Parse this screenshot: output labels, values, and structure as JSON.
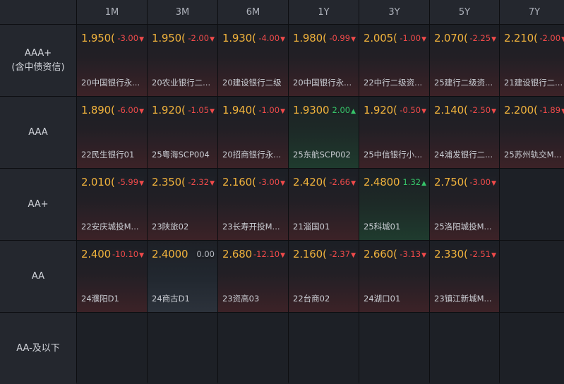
{
  "columns": [
    "1M",
    "3M",
    "6M",
    "1Y",
    "3Y",
    "5Y",
    "7Y"
  ],
  "rows": [
    {
      "label_line1": "AAA+",
      "label_line2": "(含中债资信)",
      "cells": [
        {
          "yield": "1.950(",
          "change": "-3.00",
          "dir": "down",
          "name": "20中国银行永..."
        },
        {
          "yield": "1.950(",
          "change": "-2.00",
          "dir": "down",
          "name": "20农业银行二..."
        },
        {
          "yield": "1.930(",
          "change": "-4.00",
          "dir": "down",
          "name": "20建设银行二级"
        },
        {
          "yield": "1.980(",
          "change": "-0.99",
          "dir": "down",
          "name": "20中国银行永..."
        },
        {
          "yield": "2.005(",
          "change": "-1.00",
          "dir": "down",
          "name": "22中行二级资..."
        },
        {
          "yield": "2.070(",
          "change": "-2.25",
          "dir": "down",
          "name": "25建行二级资..."
        },
        {
          "yield": "2.210(",
          "change": "-2.00",
          "dir": "down",
          "name": "21建设银行二..."
        }
      ]
    },
    {
      "label_line1": "AAA",
      "label_line2": "",
      "cells": [
        {
          "yield": "1.890(",
          "change": "-6.00",
          "dir": "down",
          "name": "22民生银行01"
        },
        {
          "yield": "1.920(",
          "change": "-1.05",
          "dir": "down",
          "name": "25粤海SCP004"
        },
        {
          "yield": "1.940(",
          "change": "-1.00",
          "dir": "down",
          "name": "20招商银行永..."
        },
        {
          "yield": "1.9300",
          "change": "2.00",
          "dir": "up",
          "name": "25东航SCP002"
        },
        {
          "yield": "1.920(",
          "change": "-0.50",
          "dir": "down",
          "name": "25中信银行小..."
        },
        {
          "yield": "2.140(",
          "change": "-2.50",
          "dir": "down",
          "name": "24浦发银行二..."
        },
        {
          "yield": "2.200(",
          "change": "-1.89",
          "dir": "down",
          "name": "25苏州轨交M..."
        }
      ]
    },
    {
      "label_line1": "AA+",
      "label_line2": "",
      "cells": [
        {
          "yield": "2.010(",
          "change": "-5.99",
          "dir": "down",
          "name": "22安庆城投M..."
        },
        {
          "yield": "2.350(",
          "change": "-2.32",
          "dir": "down",
          "name": "23陕旅02"
        },
        {
          "yield": "2.160(",
          "change": "-3.00",
          "dir": "down",
          "name": "23长寿开投M..."
        },
        {
          "yield": "2.420(",
          "change": "-2.66",
          "dir": "down",
          "name": "21淄国01"
        },
        {
          "yield": "2.4800",
          "change": "1.32",
          "dir": "up",
          "name": "25科城01"
        },
        {
          "yield": "2.750(",
          "change": "-3.00",
          "dir": "down",
          "name": "25洛阳城投M..."
        },
        null
      ]
    },
    {
      "label_line1": "AA",
      "label_line2": "",
      "cells": [
        {
          "yield": "2.400(",
          "change": "-10.10",
          "dir": "down",
          "name": "24濮阳D1"
        },
        {
          "yield": "2.4000",
          "change": "0.00",
          "dir": "flat",
          "name": "24商古D1"
        },
        {
          "yield": "2.680(",
          "change": "-12.10",
          "dir": "down",
          "name": "23资高03"
        },
        {
          "yield": "2.160(",
          "change": "-2.37",
          "dir": "down",
          "name": "22台商02"
        },
        {
          "yield": "2.660(",
          "change": "-3.13",
          "dir": "down",
          "name": "24湖口01"
        },
        {
          "yield": "2.330(",
          "change": "-2.51",
          "dir": "down",
          "name": "23镇江新城M..."
        },
        null
      ]
    },
    {
      "label_line1": "AA-及以下",
      "label_line2": "",
      "cells": [
        null,
        null,
        null,
        null,
        null,
        null,
        null
      ]
    }
  ],
  "icons": {
    "down": "triangle-down-icon",
    "up": "triangle-up-icon"
  },
  "colors": {
    "down": "#f04a4a",
    "up": "#36c46a",
    "yield": "#f0b23c"
  }
}
